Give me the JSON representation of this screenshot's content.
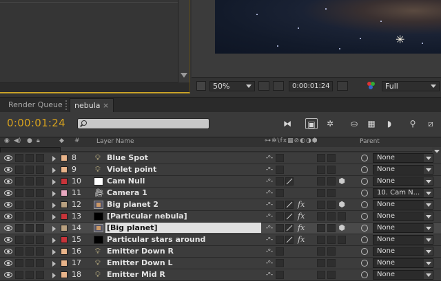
{
  "comp_toolbar": {
    "zoom": "50%",
    "timecode": "0:00:01:24",
    "resolution": "Full"
  },
  "tabs": [
    {
      "label": "Render Queue"
    },
    {
      "label": "nebula",
      "close": "×"
    }
  ],
  "timeline": {
    "current_time": "0:00:01:24",
    "search_placeholder": "",
    "columns": {
      "hash": "#",
      "layer_name": "Layer Name",
      "parent": "Parent"
    }
  },
  "layers": [
    {
      "num": "8",
      "name": "Blue Spot",
      "type": "light",
      "label_color": "#e8b48a",
      "parent": "None"
    },
    {
      "num": "9",
      "name": "Violet point",
      "type": "light",
      "label_color": "#e8b48a",
      "parent": "None"
    },
    {
      "num": "10",
      "name": "Cam Null",
      "type": "solid-white",
      "label_color": "#c8343a",
      "parent": "None"
    },
    {
      "num": "11",
      "name": "Camera 1",
      "type": "camera",
      "label_color": "#e8a8c0",
      "parent": "10. Cam N..."
    },
    {
      "num": "12",
      "name": "Big planet 2",
      "type": "comp",
      "label_color": "#b8a080",
      "parent": "None"
    },
    {
      "num": "13",
      "name": "[Particular nebula]",
      "type": "solid-black",
      "label_color": "#c8343a",
      "parent": "None"
    },
    {
      "num": "14",
      "name": "[Big planet]",
      "type": "comp",
      "label_color": "#b8a080",
      "parent": "None",
      "selected": true
    },
    {
      "num": "15",
      "name": "Particular stars around",
      "type": "solid-black",
      "label_color": "#c8343a",
      "parent": "None"
    },
    {
      "num": "16",
      "name": "Emitter Down R",
      "type": "light",
      "label_color": "#e8b48a",
      "parent": "None"
    },
    {
      "num": "17",
      "name": "Emitter Down L",
      "type": "light",
      "label_color": "#e8b48a",
      "parent": "None"
    },
    {
      "num": "18",
      "name": "Emitter Mid R",
      "type": "light",
      "label_color": "#e8b48a",
      "parent": "None"
    }
  ],
  "colors": {
    "timecode": "#d7a21e",
    "panel_highlight": "#c9a227",
    "selected_row": "#4a4a4a"
  }
}
